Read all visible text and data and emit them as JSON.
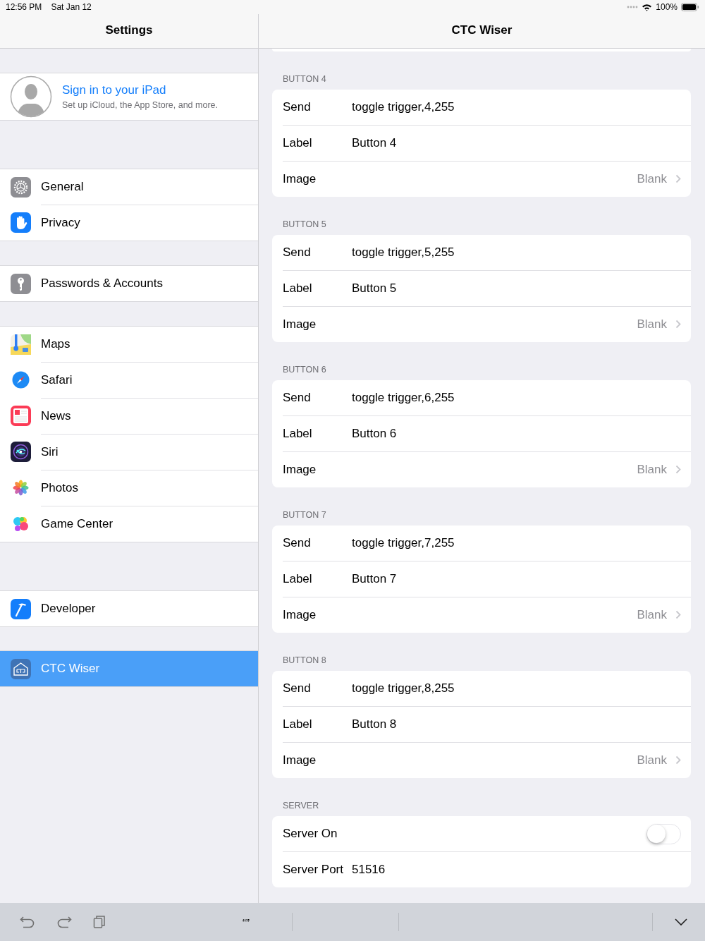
{
  "status_bar": {
    "time": "12:56 PM",
    "date": "Sat Jan 12",
    "battery": "100%"
  },
  "sidebar": {
    "title": "Settings",
    "profile": {
      "title": "Sign in to your iPad",
      "subtitle": "Set up iCloud, the App Store, and more."
    },
    "groups": [
      {
        "items": [
          {
            "label": "General",
            "selected": false
          },
          {
            "label": "Privacy",
            "selected": false
          }
        ]
      },
      {
        "items": [
          {
            "label": "Passwords & Accounts",
            "selected": false
          }
        ]
      },
      {
        "items": [
          {
            "label": "Maps",
            "selected": false
          },
          {
            "label": "Safari",
            "selected": false
          },
          {
            "label": "News",
            "selected": false
          },
          {
            "label": "Siri",
            "selected": false
          },
          {
            "label": "Photos",
            "selected": false
          },
          {
            "label": "Game Center",
            "selected": false
          }
        ]
      },
      {
        "items": [
          {
            "label": "Developer",
            "selected": false
          }
        ]
      },
      {
        "items": [
          {
            "label": "CTC Wiser",
            "selected": true
          }
        ]
      }
    ]
  },
  "detail": {
    "title": "CTC Wiser",
    "sections": [
      {
        "header": "BUTTON 4",
        "rows": [
          {
            "kind": "text",
            "label": "Send",
            "value": "toggle trigger,4,255"
          },
          {
            "kind": "text",
            "label": "Label",
            "value": "Button 4"
          },
          {
            "kind": "disclosure",
            "label": "Image",
            "detail": "Blank"
          }
        ]
      },
      {
        "header": "BUTTON 5",
        "rows": [
          {
            "kind": "text",
            "label": "Send",
            "value": "toggle trigger,5,255"
          },
          {
            "kind": "text",
            "label": "Label",
            "value": "Button 5"
          },
          {
            "kind": "disclosure",
            "label": "Image",
            "detail": "Blank"
          }
        ]
      },
      {
        "header": "BUTTON 6",
        "rows": [
          {
            "kind": "text",
            "label": "Send",
            "value": "toggle trigger,6,255"
          },
          {
            "kind": "text",
            "label": "Label",
            "value": "Button 6"
          },
          {
            "kind": "disclosure",
            "label": "Image",
            "detail": "Blank"
          }
        ]
      },
      {
        "header": "BUTTON 7",
        "rows": [
          {
            "kind": "text",
            "label": "Send",
            "value": "toggle trigger,7,255"
          },
          {
            "kind": "text",
            "label": "Label",
            "value": "Button 7"
          },
          {
            "kind": "disclosure",
            "label": "Image",
            "detail": "Blank"
          }
        ]
      },
      {
        "header": "BUTTON 8",
        "rows": [
          {
            "kind": "text",
            "label": "Send",
            "value": "toggle trigger,8,255"
          },
          {
            "kind": "text",
            "label": "Label",
            "value": "Button 8"
          },
          {
            "kind": "disclosure",
            "label": "Image",
            "detail": "Blank"
          }
        ]
      },
      {
        "header": "SERVER",
        "rows": [
          {
            "kind": "toggle",
            "label": "Server On",
            "on": false
          },
          {
            "kind": "text",
            "label": "Server Port",
            "value": "51516"
          }
        ]
      }
    ]
  },
  "keyboard_bar": {
    "quote_key": "“”"
  }
}
